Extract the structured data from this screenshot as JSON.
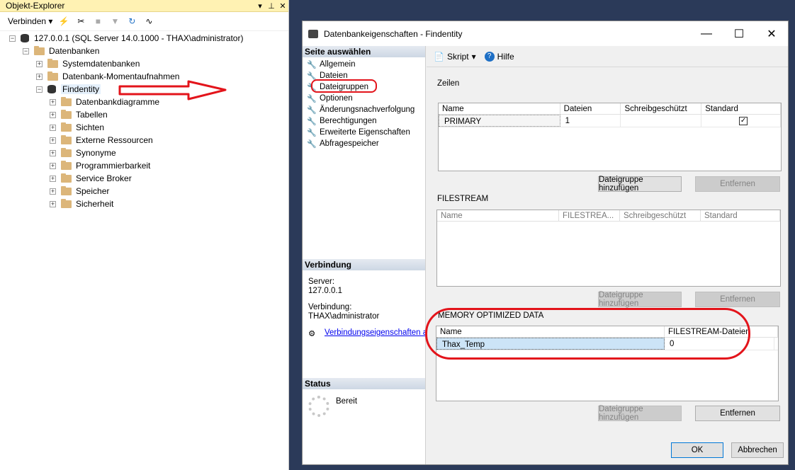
{
  "object_explorer": {
    "title": "Objekt-Explorer",
    "connect_label": "Verbinden",
    "server": "127.0.0.1 (SQL Server 14.0.1000 - THAX\\administrator)",
    "databases": "Datenbanken",
    "system_databases": "Systemdatenbanken",
    "snapshots": "Datenbank-Momentaufnahmen",
    "db_name": "Findentity",
    "children": [
      "Datenbankdiagramme",
      "Tabellen",
      "Sichten",
      "Externe Ressourcen",
      "Synonyme",
      "Programmierbarkeit",
      "Service Broker",
      "Speicher",
      "Sicherheit"
    ]
  },
  "dialog": {
    "title": "Datenbankeigenschaften - Findentity",
    "select_page": "Seite auswählen",
    "pages": [
      "Allgemein",
      "Dateien",
      "Dateigruppen",
      "Optionen",
      "Änderungsnachverfolgung",
      "Berechtigungen",
      "Erweiterte Eigenschaften",
      "Abfragespeicher"
    ],
    "connection_header": "Verbindung",
    "server_label": "Server:",
    "server_value": "127.0.0.1",
    "conn_label": "Verbindung:",
    "conn_value": "THAX\\administrator",
    "conn_props_link": "Verbindungseigenschaften anzeigen",
    "status_header": "Status",
    "status_value": "Bereit",
    "script_label": "Skript",
    "help_label": "Hilfe",
    "rows_title": "Zeilen",
    "rows_columns": [
      "Name",
      "Dateien",
      "Schreibgeschützt",
      "Standard"
    ],
    "rows_data": {
      "name": "PRIMARY",
      "files": "1",
      "readonly": "",
      "default_checked": true
    },
    "filestream_title": "FILESTREAM",
    "filestream_columns": [
      "Name",
      "FILESTREA...",
      "Schreibgeschützt",
      "Standard"
    ],
    "memory_title": "MEMORY OPTIMIZED DATA",
    "memory_columns": [
      "Name",
      "FILESTREAM-Dateien"
    ],
    "memory_data": {
      "name": "Thax_Temp",
      "files": "0"
    },
    "add_filegroup": "Dateigruppe hinzufügen",
    "remove": "Entfernen",
    "ok": "OK",
    "cancel": "Abbrechen"
  },
  "colors": {
    "annotation_red": "#e3141b",
    "selection": "#cce4f7"
  }
}
